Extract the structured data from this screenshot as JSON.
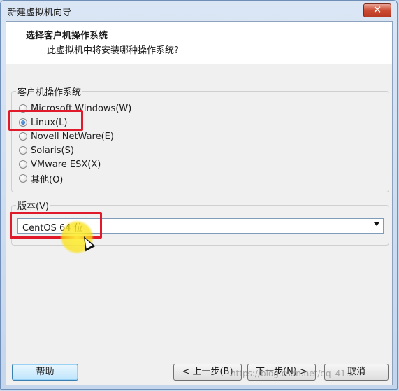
{
  "window": {
    "title": "新建虚拟机向导",
    "close_label": "✕"
  },
  "header": {
    "title": "选择客户机操作系统",
    "subtitle": "此虚拟机中将安装哪种操作系统?"
  },
  "os_group": {
    "label": "客户机操作系统",
    "options": [
      {
        "label": "Microsoft Windows(W)",
        "checked": false
      },
      {
        "label": "Linux(L)",
        "checked": true
      },
      {
        "label": "Novell NetWare(E)",
        "checked": false
      },
      {
        "label": "Solaris(S)",
        "checked": false
      },
      {
        "label": "VMware ESX(X)",
        "checked": false
      },
      {
        "label": "其他(O)",
        "checked": false
      }
    ]
  },
  "version_group": {
    "label": "版本(V)",
    "selected": "CentOS 64 位"
  },
  "buttons": {
    "help": "帮助",
    "back": "< 上一步(B)",
    "next": "下一步(N) >",
    "cancel": "取消"
  },
  "watermark": "https://blog.csdn.net/qq_41..."
}
